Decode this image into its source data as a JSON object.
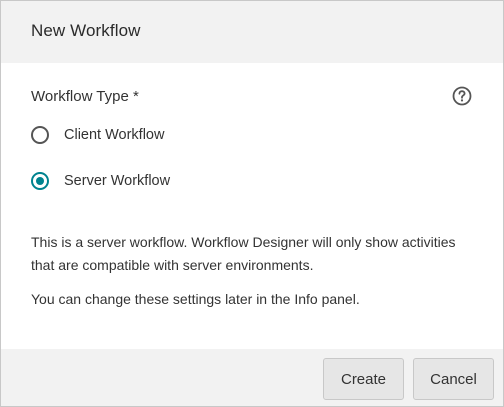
{
  "dialog": {
    "title": "New Workflow"
  },
  "form": {
    "field_label": "Workflow Type *",
    "help_icon": "question-circle-icon",
    "options": [
      {
        "label": "Client Workflow",
        "selected": false
      },
      {
        "label": "Server Workflow",
        "selected": true
      }
    ],
    "description": "This is a server workflow. Workflow Designer will only show activities that are compatible with server environments.",
    "note": "You can change these settings later in the Info panel."
  },
  "footer": {
    "create_label": "Create",
    "cancel_label": "Cancel"
  },
  "colors": {
    "accent": "#00838f",
    "header_bg": "#f2f2f2",
    "button_bg": "#e6e6e6"
  }
}
